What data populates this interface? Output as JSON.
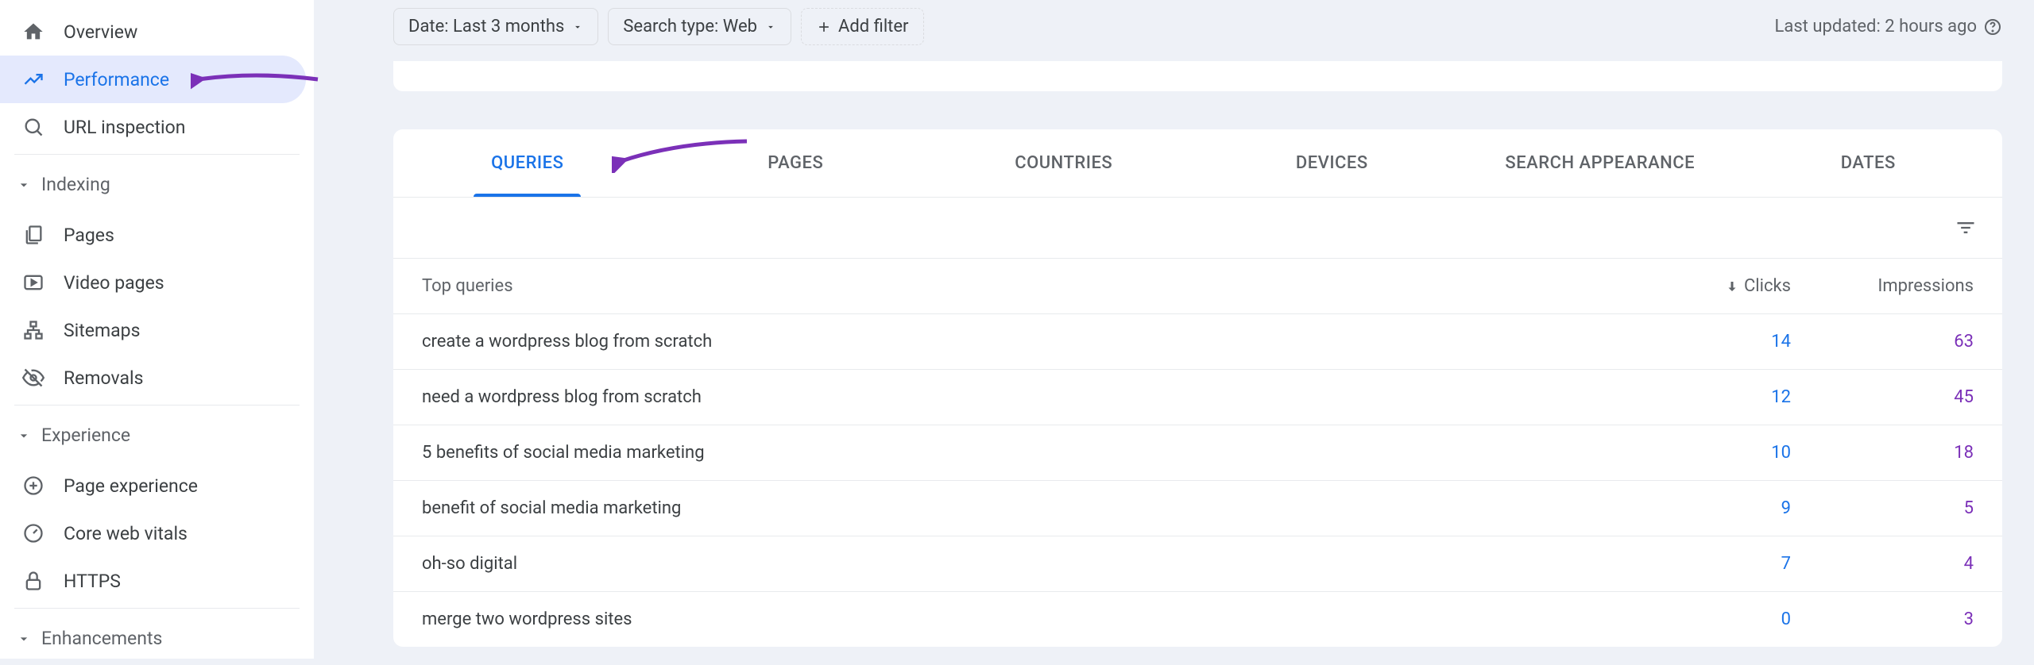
{
  "sidebar": {
    "items": [
      {
        "label": "Overview",
        "icon": "home"
      },
      {
        "label": "Performance",
        "icon": "trending-up",
        "active": true
      },
      {
        "label": "URL inspection",
        "icon": "search"
      }
    ],
    "sections": [
      {
        "title": "Indexing",
        "items": [
          {
            "label": "Pages",
            "icon": "file-copy"
          },
          {
            "label": "Video pages",
            "icon": "video"
          },
          {
            "label": "Sitemaps",
            "icon": "sitemap"
          },
          {
            "label": "Removals",
            "icon": "visibility-off"
          }
        ]
      },
      {
        "title": "Experience",
        "items": [
          {
            "label": "Page experience",
            "icon": "add-circle"
          },
          {
            "label": "Core web vitals",
            "icon": "speed"
          },
          {
            "label": "HTTPS",
            "icon": "lock"
          }
        ]
      },
      {
        "title": "Enhancements",
        "items": []
      }
    ]
  },
  "filters": {
    "date": "Date: Last 3 months",
    "search_type": "Search type: Web",
    "add_filter": "Add filter"
  },
  "last_updated": "Last updated: 2 hours ago",
  "tabs": [
    "QUERIES",
    "PAGES",
    "COUNTRIES",
    "DEVICES",
    "SEARCH APPEARANCE",
    "DATES"
  ],
  "active_tab": 0,
  "table": {
    "headers": {
      "query": "Top queries",
      "clicks": "Clicks",
      "impressions": "Impressions"
    },
    "rows": [
      {
        "query": "create a wordpress blog from scratch",
        "clicks": "14",
        "impressions": "63"
      },
      {
        "query": "need a wordpress blog from scratch",
        "clicks": "12",
        "impressions": "45"
      },
      {
        "query": "5 benefits of social media marketing",
        "clicks": "10",
        "impressions": "18"
      },
      {
        "query": "benefit of social media marketing",
        "clicks": "9",
        "impressions": "5"
      },
      {
        "query": "oh-so digital",
        "clicks": "7",
        "impressions": "4"
      },
      {
        "query": "merge two wordpress sites",
        "clicks": "0",
        "impressions": "3"
      }
    ]
  }
}
